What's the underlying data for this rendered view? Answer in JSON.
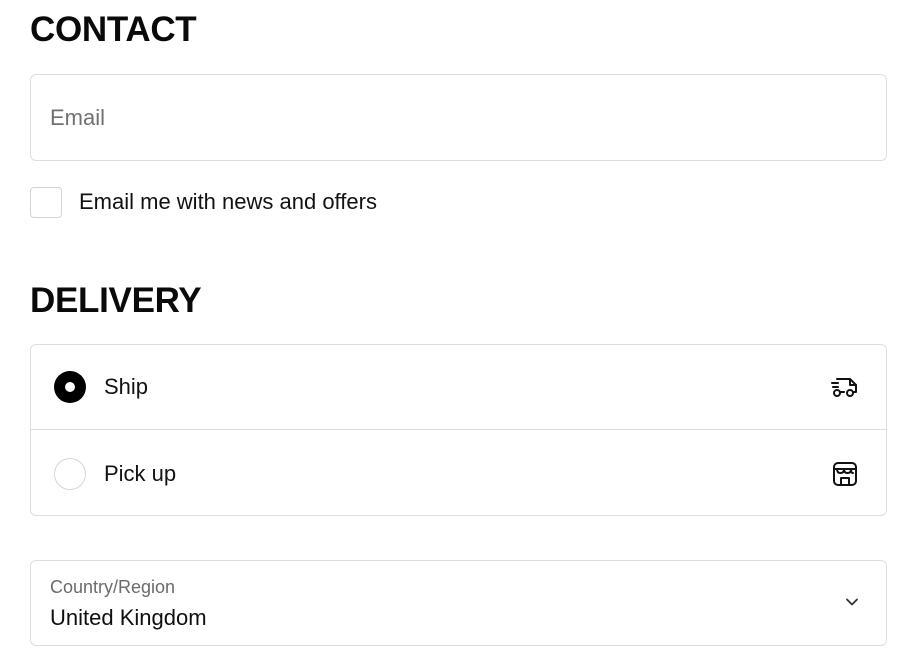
{
  "contact": {
    "heading": "CONTACT",
    "email_placeholder": "Email",
    "email_value": "",
    "newsletter_label": "Email me with news and offers",
    "newsletter_checked": false
  },
  "delivery": {
    "heading": "DELIVERY",
    "options": [
      {
        "label": "Ship",
        "selected": true,
        "icon": "truck-icon"
      },
      {
        "label": "Pick up",
        "selected": false,
        "icon": "store-icon"
      }
    ],
    "country": {
      "caption": "Country/Region",
      "value": "United Kingdom",
      "icon": "chevron-down-icon"
    }
  },
  "colors": {
    "text": "#0a0a0a",
    "border": "#dedede",
    "placeholder": "#707070",
    "radio_selected": "#000000"
  }
}
